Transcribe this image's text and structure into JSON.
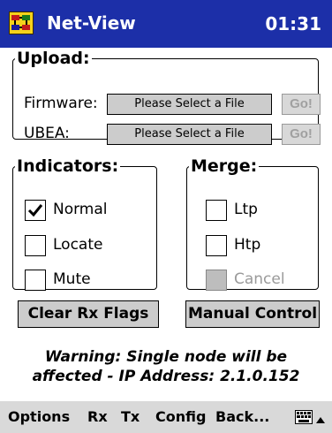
{
  "titlebar": {
    "title": "Net-View",
    "time": "01:31",
    "icon": "netview-app-icon"
  },
  "upload": {
    "legend": "Upload:",
    "rows": [
      {
        "label": "Firmware:",
        "file_button": "Please Select a File",
        "go_button": "Go!"
      },
      {
        "label": "UBEA:",
        "file_button": "Please Select a File",
        "go_button": "Go!"
      }
    ]
  },
  "indicators": {
    "legend": "Indicators:",
    "items": [
      {
        "label": "Normal",
        "checked": true
      },
      {
        "label": "Locate",
        "checked": false
      },
      {
        "label": "Mute",
        "checked": false
      }
    ]
  },
  "merge": {
    "legend": "Merge:",
    "items": [
      {
        "label": "Ltp",
        "checked": false,
        "enabled": true
      },
      {
        "label": "Htp",
        "checked": false,
        "enabled": true
      },
      {
        "label": "Cancel",
        "checked": false,
        "enabled": false
      }
    ]
  },
  "buttons": {
    "clear_rx": "Clear Rx Flags",
    "manual_control": "Manual Control"
  },
  "warning": {
    "line1": "Warning: Single node will be",
    "line2": "affected - IP Address: 2.1.0.152"
  },
  "menubar": {
    "items": [
      "Options",
      "Rx",
      "Tx",
      "Config",
      "Back..."
    ],
    "keyboard_icon": "keyboard-icon",
    "arrow_icon": "up-arrow-icon"
  },
  "colors": {
    "titlebar": "#1c2fa8",
    "button_face": "#cccccc",
    "menubar": "#d9d9d9",
    "disabled_text": "#a0a0a0"
  }
}
